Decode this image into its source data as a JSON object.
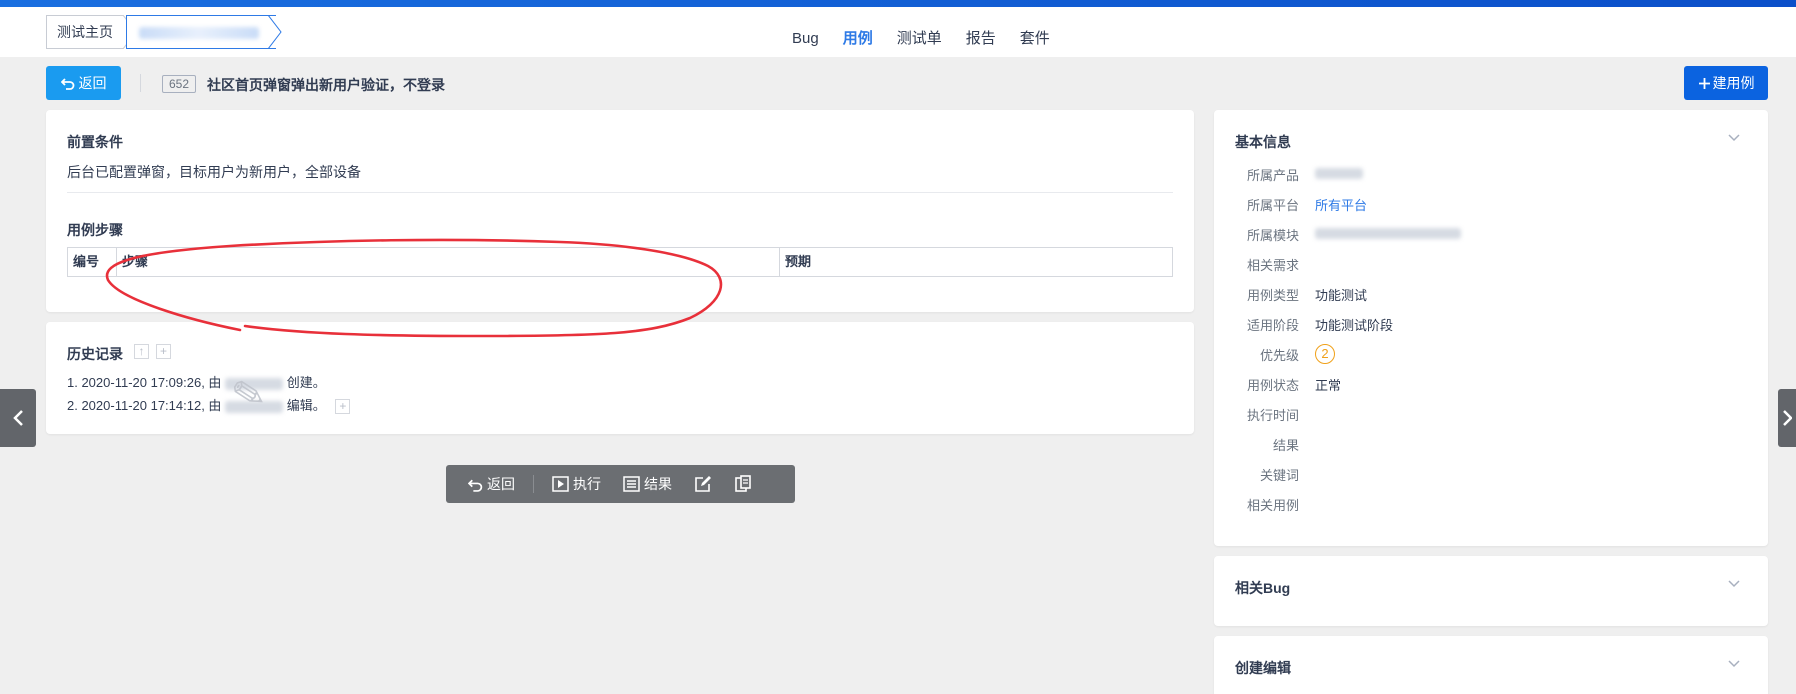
{
  "header": {
    "breadcrumb_home": "测试主页",
    "nav": [
      {
        "label": "Bug",
        "active": false
      },
      {
        "label": "用例",
        "active": true
      },
      {
        "label": "测试单",
        "active": false
      },
      {
        "label": "报告",
        "active": false
      },
      {
        "label": "套件",
        "active": false
      }
    ]
  },
  "toolbar": {
    "back_label": "返回",
    "case_id": "652",
    "case_title": "社区首页弹窗弹出新用户验证，不登录",
    "create_label": "建用例"
  },
  "precondition": {
    "title": "前置条件",
    "text": "后台已配置弹窗，目标用户为新用户，全部设备"
  },
  "steps": {
    "title": "用例步骤",
    "columns": [
      "编号",
      "步骤",
      "预期"
    ]
  },
  "history": {
    "title": "历史记录",
    "entries": [
      {
        "prefix": "1. 2020-11-20 17:09:26, 由",
        "suffix": "创建。"
      },
      {
        "prefix": "2. 2020-11-20 17:14:12, 由",
        "suffix": "编辑。"
      }
    ]
  },
  "actions": {
    "back": "返回",
    "execute": "执行",
    "result": "结果"
  },
  "info": {
    "title": "基本信息",
    "rows": [
      {
        "label": "所属产品",
        "value": ""
      },
      {
        "label": "所属平台",
        "value": "所有平台"
      },
      {
        "label": "所属模块",
        "value": ""
      },
      {
        "label": "相关需求",
        "value": ""
      },
      {
        "label": "用例类型",
        "value": "功能测试"
      },
      {
        "label": "适用阶段",
        "value": "功能测试阶段"
      },
      {
        "label": "优先级",
        "value": "2"
      },
      {
        "label": "用例状态",
        "value": "正常"
      },
      {
        "label": "执行时间",
        "value": ""
      },
      {
        "label": "结果",
        "value": ""
      },
      {
        "label": "关键词",
        "value": ""
      },
      {
        "label": "相关用例",
        "value": ""
      }
    ]
  },
  "related_bug": {
    "title": "相关Bug"
  },
  "create_edit": {
    "title": "创建编辑"
  },
  "colors": {
    "accent": "#2e7ae6",
    "back_button": "#1a9bf0",
    "create_button": "#0b63e0",
    "priority": "#f0a11a",
    "annotation": "#e8303a"
  }
}
